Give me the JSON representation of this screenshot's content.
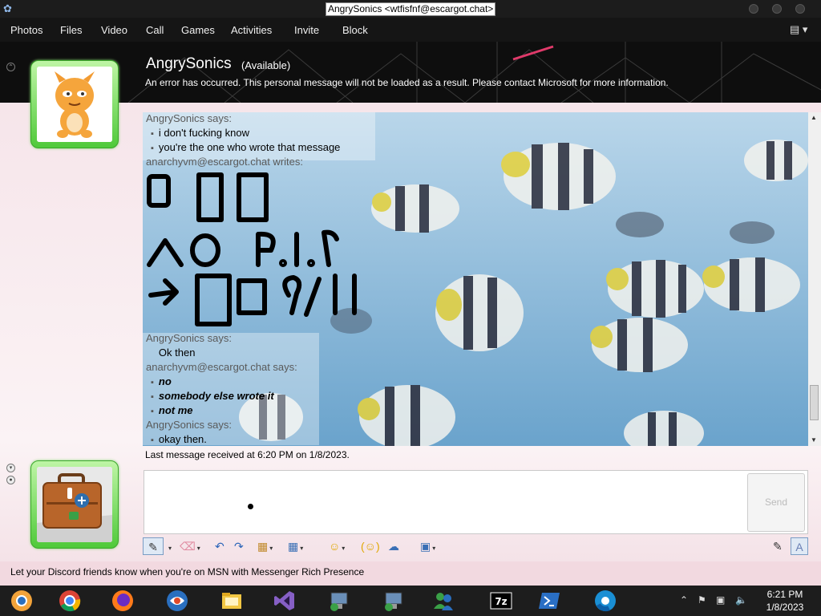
{
  "window": {
    "title": "AngrySonics <wtfisfnf@escargot.chat>",
    "app_icon": "msn-messenger-icon"
  },
  "menu": {
    "items": [
      "Photos",
      "Files",
      "Video",
      "Call",
      "Games",
      "Activities",
      "Invite",
      "Block"
    ]
  },
  "contact": {
    "name": "AngrySonics",
    "status": "(Available)",
    "personal_message": "An error has occurred. This personal message will not be loaded as a result. Please contact Microsoft for more information."
  },
  "conversation": {
    "lines": [
      {
        "kind": "sender",
        "text": "AngrySonics says:"
      },
      {
        "kind": "msg",
        "text": "i don't fucking know"
      },
      {
        "kind": "msg",
        "text": "you're the one who wrote that message"
      },
      {
        "kind": "sender",
        "text": "anarchyvm@escargot.chat writes:"
      },
      {
        "kind": "sender",
        "text": "AngrySonics says:"
      },
      {
        "kind": "msg",
        "text": "Ok then"
      },
      {
        "kind": "sender",
        "text": "anarchyvm@escargot.chat says:"
      },
      {
        "kind": "bold",
        "text": "no"
      },
      {
        "kind": "bold",
        "text": "somebody else wrote it"
      },
      {
        "kind": "bold",
        "text": "not me"
      },
      {
        "kind": "sender",
        "text": "AngrySonics says:"
      },
      {
        "kind": "msg",
        "text": "okay then."
      }
    ],
    "last_message": "Last message received at 6:20 PM on 1/8/2023."
  },
  "compose": {
    "send_label": "Send"
  },
  "ad": {
    "text": "Let your Discord friends know when you're on MSN with Messenger Rich Presence"
  },
  "taskbar": {
    "apps": [
      "chrome-canary-icon",
      "chrome-icon",
      "firefox-icon",
      "msn-icon",
      "file-explorer-icon",
      "visual-studio-icon",
      "network-setup-icon",
      "network-setup-icon-2",
      "messenger-people-icon",
      "7zip-icon",
      "powershell-icon",
      "chrome-beta-icon"
    ],
    "time": "6:21 PM",
    "date": "1/8/2023"
  },
  "colors": {
    "avatar_frame": "#4fc93a",
    "header_bg": "#0e0e0e",
    "body_bg": "#f6e5ea"
  }
}
